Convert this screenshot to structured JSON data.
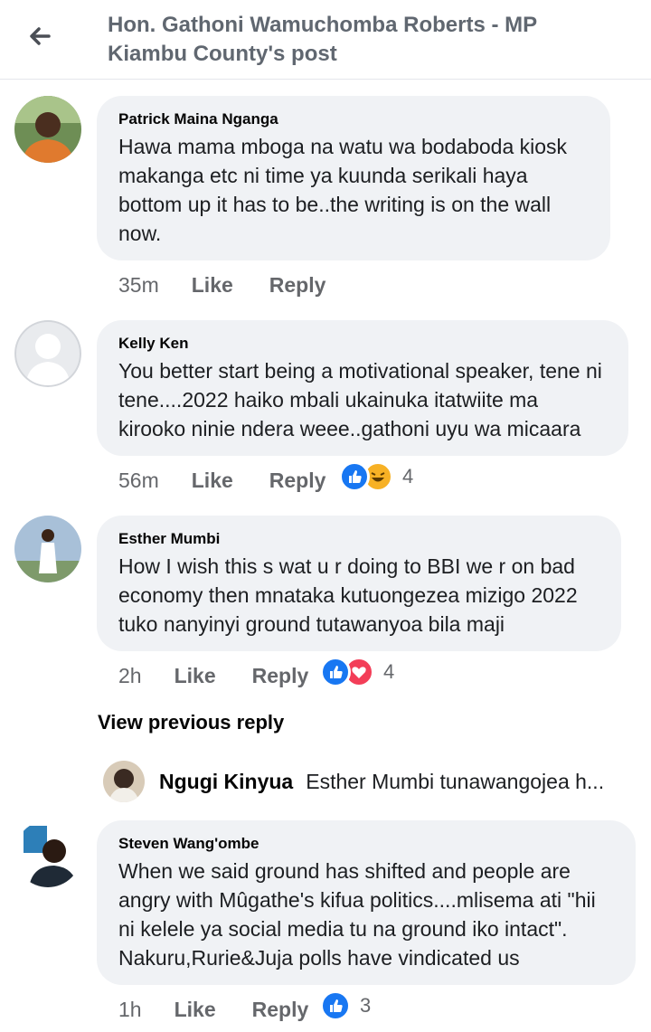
{
  "header": {
    "title": "Hon. Gathoni Wamuchomba Roberts - MP Kiambu County's post"
  },
  "comments": [
    {
      "author": "Patrick Maina Nganga",
      "text": "Hawa mama mboga na watu wa bodaboda kiosk makanga etc ni time ya kuunda serikali haya bottom up  it has to be..the writing is on the wall now.",
      "time": "35m",
      "like": "Like",
      "reply": "Reply",
      "reaction_count": ""
    },
    {
      "author": "Kelly Ken",
      "text": "You better start being a motivational speaker, tene ni tene....2022 haiko mbali ukainuka itatwiite ma kirooko ninie ndera weee..gathoni uyu wa micaara",
      "time": "56m",
      "like": "Like",
      "reply": "Reply",
      "reaction_count": "4",
      "reactions": [
        "like-icon",
        "haha-icon"
      ]
    },
    {
      "author": "Esther Mumbi",
      "text": "How I wish this s wat u r doing to BBI we r on bad economy then mnataka kutuongezea mizigo 2022 tuko nanyinyi ground tutawanyoa bila maji",
      "time": "2h",
      "like": "Like",
      "reply": "Reply",
      "reaction_count": "4",
      "reactions": [
        "like-icon",
        "love-icon"
      ]
    },
    {
      "author": "Steven Wang'ombe",
      "text": "When we said ground has shifted and people are angry with Mûgathe's kifua politics....mlisema ati \"hii ni kelele ya social media tu na ground iko intact\".  Nakuru,Rurie&Juja polls have vindicated us",
      "time": "1h",
      "like": "Like",
      "reply": "Reply",
      "reaction_count": "3",
      "reactions": [
        "like-icon"
      ]
    }
  ],
  "view_previous_reply": "View previous reply",
  "nested_reply": {
    "author": "Ngugi Kinyua",
    "text": "Esther Mumbi tunawangojea h..."
  },
  "colors": {
    "bubble": "#f0f2f5",
    "like_blue": "#1877f2",
    "haha_yellow": "#f7b125",
    "love_red": "#f33e58",
    "meta_gray": "#65676b"
  }
}
